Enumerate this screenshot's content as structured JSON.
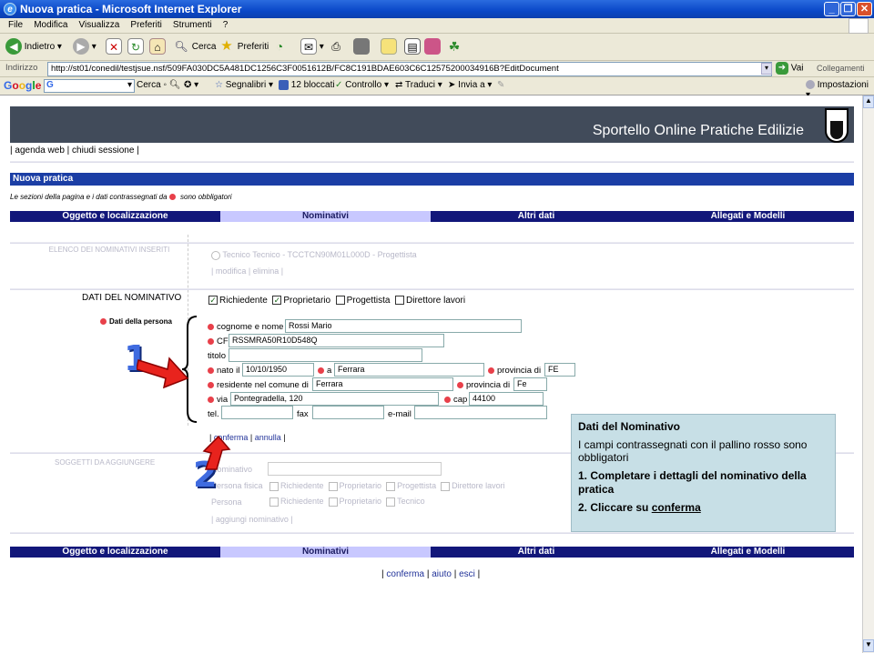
{
  "window": {
    "title": "Nuova pratica - Microsoft Internet Explorer"
  },
  "menu": [
    "File",
    "Modifica",
    "Visualizza",
    "Preferiti",
    "Strumenti",
    "?"
  ],
  "toolbar": {
    "back": "Indietro",
    "search": "Cerca",
    "favorites": "Preferiti"
  },
  "address": {
    "label": "Indirizzo",
    "url": "http://st01/conedil/testjsue.nsf/509FA030DC5A481DC1256C3F0051612B/FC8C191BDAE603C6C12575200034916B?EditDocument",
    "go": "Vai",
    "links": "Collegamenti"
  },
  "googlebar": {
    "search": "Cerca",
    "bookmarks": "Segnalibri",
    "blocked": "12 bloccati",
    "check": "Controllo",
    "translate": "Traduci",
    "send": "Invia a",
    "settings": "Impostazioni"
  },
  "site": {
    "title": "Sportello Online Pratiche Edilizie",
    "nav": [
      "agenda web",
      "chiudi sessione"
    ],
    "page_title": "Nuova pratica",
    "required_note": "Le sezioni della pagina e i dati contrassegnati da",
    "required_note_end": "sono obbligatori"
  },
  "tabs": [
    "Oggetto e localizzazione",
    "Nominativi",
    "Altri dati",
    "Allegati e Modelli"
  ],
  "elenco": {
    "label": "ELENCO DEI NOMINATIVI INSERITI",
    "entry": "Tecnico Tecnico - TCCTCN90M01L000D - Progettista",
    "links": "| modifica | elimina |"
  },
  "dati": {
    "section_label": "DATI DEL NOMINATIVO",
    "roles": [
      {
        "label": "Richiedente",
        "checked": true
      },
      {
        "label": "Proprietario",
        "checked": true
      },
      {
        "label": "Progettista",
        "checked": false
      },
      {
        "label": "Direttore lavori",
        "checked": false
      }
    ],
    "persona_label": "Dati della persona",
    "fields": {
      "cognome_label": "cognome e nome",
      "cognome": "Rossi Mario",
      "cf_label": "CF",
      "cf": "RSSMRA50R10D548Q",
      "titolo_label": "titolo",
      "titolo": "",
      "nato_label": "nato il",
      "nato": "10/10/1950",
      "a_label": "a",
      "a": "Ferrara",
      "prov_label": "provincia di",
      "prov": "FE",
      "res_label": "residente nel comune di",
      "res": "Ferrara",
      "prov2_label": "provincia di",
      "prov2": "Fe",
      "via_label": "via",
      "via": "Pontegradella, 120",
      "cap_label": "cap",
      "cap": "44100",
      "tel_label": "tel.",
      "fax_label": "fax",
      "email_label": "e-mail"
    },
    "actions": {
      "confirm": "conferma",
      "cancel": "annulla"
    }
  },
  "soggetti": {
    "label": "SOGGETTI DA AGGIUNGERE",
    "row1": "Nominativo",
    "row2": "Persona fisica",
    "row3": "Persona",
    "cbs": [
      "Richiedente",
      "Proprietario",
      "Progettista",
      "Direttore lavori",
      "Richiedente",
      "Proprietario",
      "Tecnico"
    ],
    "more": "| aggiungi nominativo |"
  },
  "footer_links": [
    "conferma",
    "aiuto",
    "esci"
  ],
  "annotations": {
    "one": "1",
    "two": "2"
  },
  "info": {
    "title": "Dati del Nominativo",
    "text": "I campi contrassegnati con il pallino rosso sono obbligatori",
    "step1": "1. Completare i dettagli del nominativo della pratica",
    "step2_prefix": "2. Cliccare su ",
    "step2_link": "conferma"
  }
}
